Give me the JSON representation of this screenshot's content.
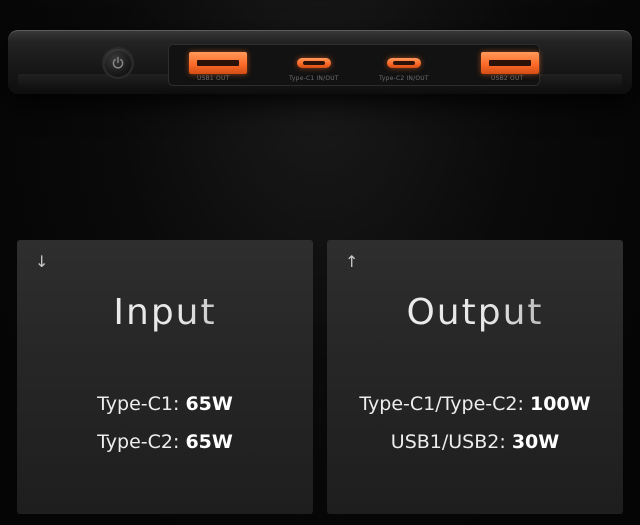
{
  "device": {
    "ports": [
      {
        "type": "usb-a",
        "label": "USB1 OUT"
      },
      {
        "type": "usb-c",
        "label": "Type-C1 IN/OUT"
      },
      {
        "type": "usb-c",
        "label": "Type-C2 IN/OUT"
      },
      {
        "type": "usb-a",
        "label": "USB2 OUT"
      }
    ],
    "port_color": "#ff6b2a",
    "power_icon": "power-icon"
  },
  "cards": {
    "input": {
      "arrow": "↓",
      "title": "Input",
      "specs": [
        {
          "label": "Type-C1:",
          "value": "65W"
        },
        {
          "label": "Type-C2:",
          "value": "65W"
        }
      ]
    },
    "output": {
      "arrow": "↑",
      "title": "Output",
      "specs": [
        {
          "label": "Type-C1/Type-C2:",
          "value": "100W"
        },
        {
          "label": "USB1/USB2:",
          "value": "30W"
        }
      ]
    }
  }
}
